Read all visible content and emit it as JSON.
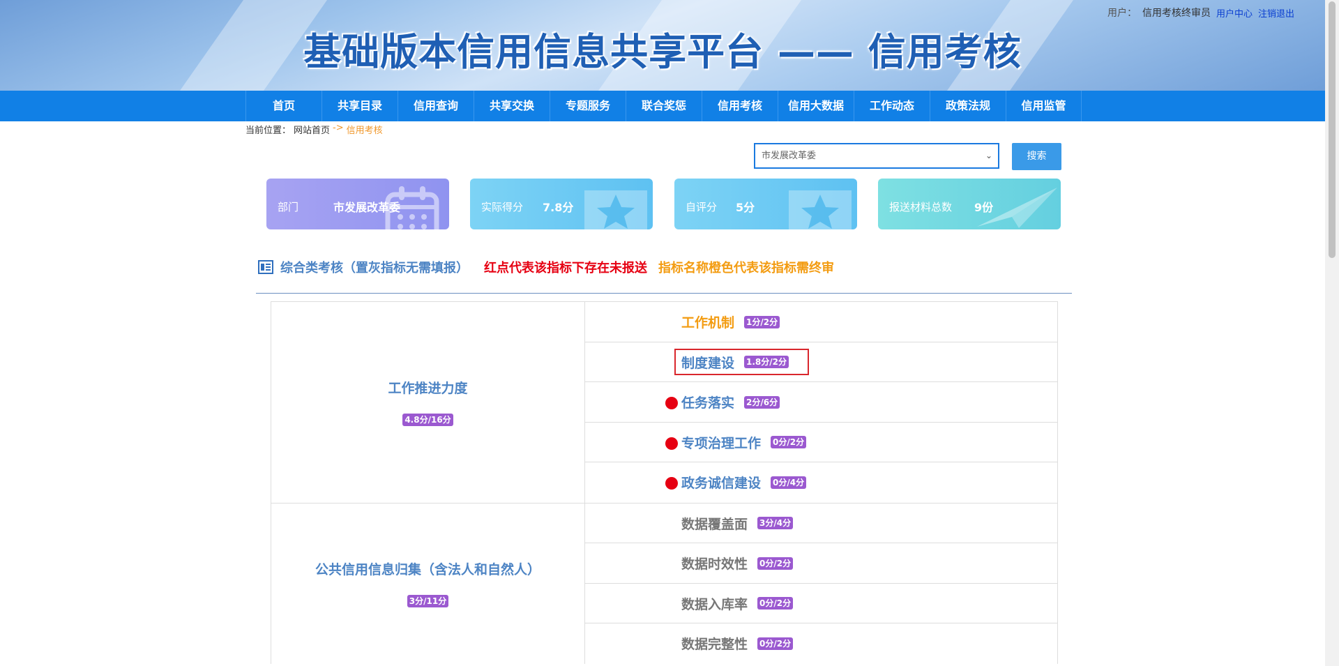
{
  "header": {
    "title": "基础版本信用信息共享平台 —— 信用考核",
    "user_label": "用户：",
    "user_name": "信用考核终审员",
    "user_center": "用户中心",
    "logout": "注销退出"
  },
  "nav": [
    "首页",
    "共享目录",
    "信用查询",
    "共享交换",
    "专题服务",
    "联合奖惩",
    "信用考核",
    "信用大数据",
    "工作动态",
    "政策法规",
    "信用监管"
  ],
  "breadcrumb": {
    "prefix": "当前位置：",
    "home": "网站首页",
    "sep": "->",
    "current": "信用考核"
  },
  "search": {
    "selected": "市发展改革委",
    "button": "搜索"
  },
  "cards": [
    {
      "key": "部门",
      "value": "市发展改革委",
      "icon": "calendar-icon"
    },
    {
      "key": "实际得分",
      "value": "7.8分",
      "icon": "star-icon"
    },
    {
      "key": "自评分",
      "value": "5分",
      "icon": "star-icon"
    },
    {
      "key": "报送材料总数",
      "value": "9份",
      "icon": "paper-plane-icon"
    }
  ],
  "section": {
    "title": "综合类考核（置灰指标无需填报）",
    "red_note": "红点代表该指标下存在未报送",
    "orange_note": "指标名称橙色代表该指标需终审"
  },
  "groups": [
    {
      "name": "工作推进力度",
      "score": "4.8分/16分",
      "items": [
        {
          "label": "工作机制",
          "score": "1分/2分",
          "color": "#f39c12",
          "dot": false
        },
        {
          "label": "制度建设",
          "score": "1.8分/2分",
          "color": "#4d84c4",
          "dot": false
        },
        {
          "label": "任务落实",
          "score": "2分/6分",
          "color": "#4d84c4",
          "dot": true
        },
        {
          "label": "专项治理工作",
          "score": "0分/2分",
          "color": "#4d84c4",
          "dot": true
        },
        {
          "label": "政务诚信建设",
          "score": "0分/4分",
          "color": "#4d84c4",
          "dot": true
        }
      ]
    },
    {
      "name": "公共信用信息归集（含法人和自然人）",
      "score": "3分/11分",
      "items": [
        {
          "label": "数据覆盖面",
          "score": "3分/4分",
          "color": "#777777",
          "dot": false
        },
        {
          "label": "数据时效性",
          "score": "0分/2分",
          "color": "#777777",
          "dot": false
        },
        {
          "label": "数据入库率",
          "score": "0分/2分",
          "color": "#777777",
          "dot": false
        },
        {
          "label": "数据完整性",
          "score": "0分/2分",
          "color": "#777777",
          "dot": false
        }
      ]
    }
  ],
  "colors": {
    "nav_bg": "#1180e6",
    "badge": "#9b59d0",
    "red_dot": "#e60012"
  }
}
